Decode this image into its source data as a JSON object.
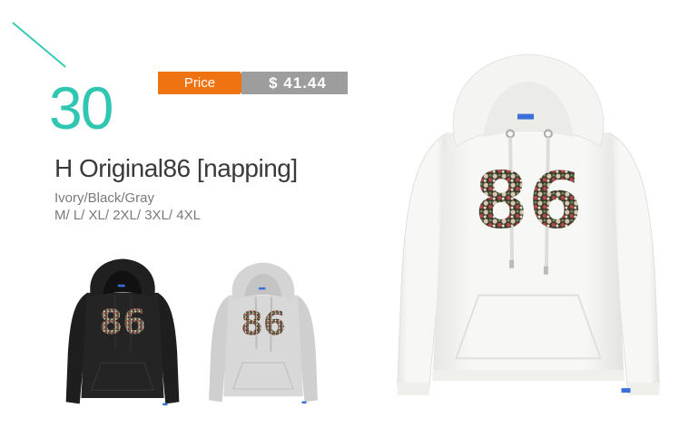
{
  "product": {
    "number": "30",
    "price_label": "Price",
    "price_value": "$ 41.44",
    "title": "H Original86 [napping]",
    "colors_line": "Ivory/Black/Gray",
    "sizes_line": "M/ L/ XL/ 2XL/ 3XL/ 4XL"
  },
  "print_text": "86",
  "palette": {
    "accent": "#2fc6b2",
    "price_tag": "#f07312",
    "price_value_bg": "#9d9d9d",
    "ivory": "#f6f6f4",
    "black": "#1e1e1e",
    "gray": "#d6d6d6"
  }
}
